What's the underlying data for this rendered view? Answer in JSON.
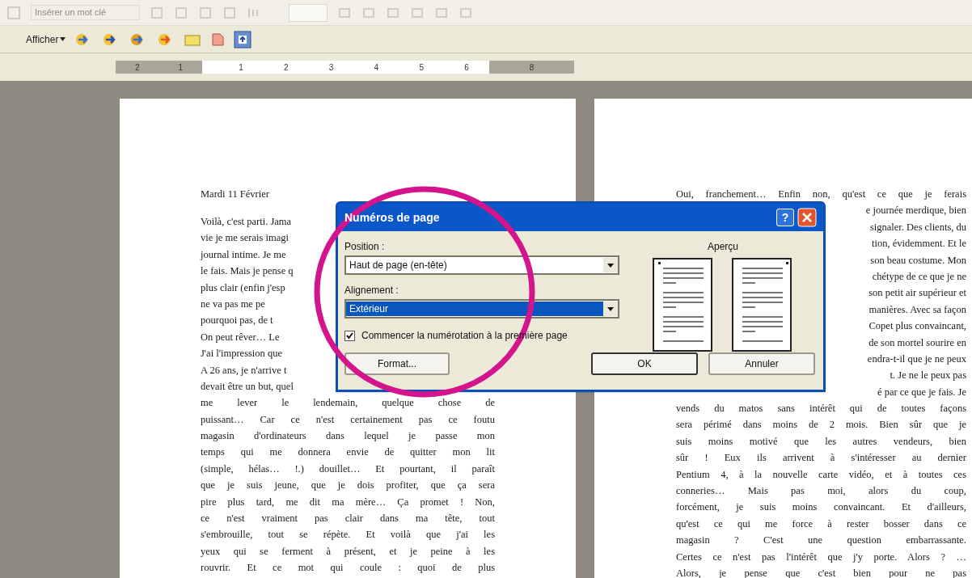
{
  "toolbar": {
    "keyword_field": "Insérer un mot clé",
    "view_menu": "Afficher"
  },
  "ruler": {
    "left_numbers": [
      "2",
      "1"
    ],
    "numbers": [
      "1",
      "2",
      "3",
      "4",
      "5",
      "6"
    ],
    "right_numbers": [
      "8"
    ]
  },
  "pages": [
    {
      "lines": [
        {
          "kind": "heading",
          "text": "Mardi 11 Février"
        },
        {
          "kind": "start",
          "text": "Voilà, c'est parti. Jama"
        },
        {
          "kind": "start",
          "text": "vie je me serais imagi"
        },
        {
          "kind": "start",
          "text": "journal intime. Je me"
        },
        {
          "kind": "start",
          "text": "le fais. Mais je pense q"
        },
        {
          "kind": "start",
          "text": "plus clair (enfin j'esp"
        },
        {
          "kind": "start",
          "text": "ne va pas me pe"
        },
        {
          "kind": "start",
          "text": "pourquoi pas, de t"
        },
        {
          "kind": "start",
          "text": "On peut rêver… Le"
        },
        {
          "kind": "start",
          "text": "J'ai l'impression que"
        },
        {
          "kind": "start",
          "text": "A 26 ans, je n'arrive t"
        },
        {
          "kind": "start",
          "text": "devait être un but, quel"
        },
        {
          "kind": "full",
          "text": "me lever le lendemain, quelque chose de"
        },
        {
          "kind": "full",
          "text": "puissant… Car ce n'est certainement pas ce foutu"
        },
        {
          "kind": "full",
          "text": "magasin d'ordinateurs dans lequel je passe mon"
        },
        {
          "kind": "full",
          "text": "temps qui me donnera envie de quitter mon lit"
        },
        {
          "kind": "full",
          "text": "(simple, hélas… !.) douillet… Et pourtant, il paraît"
        },
        {
          "kind": "full",
          "text": "que je suis jeune, que je dois profiter, que ça sera"
        },
        {
          "kind": "full",
          "text": "pire plus tard, me dit ma mère… Ça promet ! Non,"
        },
        {
          "kind": "full",
          "text": "ce n'est vraiment pas clair dans ma tête, tout"
        },
        {
          "kind": "full",
          "text": "s'embrouille, tout se répète. Et voilà que j'ai les"
        },
        {
          "kind": "full",
          "text": "yeux qui se ferment à présent, et je peine à les"
        },
        {
          "kind": "full",
          "text": "rouvrir. Et ce mot qui coule : quoi de plus"
        }
      ]
    },
    {
      "lines": [
        {
          "kind": "full",
          "text": "Oui, franchement… Enfin non, qu'est ce que je ferais"
        },
        {
          "kind": "end",
          "text": "e journée merdique, bien"
        },
        {
          "kind": "end",
          "text": "signaler. Des clients, du"
        },
        {
          "kind": "end",
          "text": "tion, évidemment. Et le"
        },
        {
          "kind": "end",
          "text": "son beau costume. Mon"
        },
        {
          "kind": "end",
          "text": "chétype de ce que je ne"
        },
        {
          "kind": "end",
          "text": "son petit air supérieur et"
        },
        {
          "kind": "end",
          "text": "manières. Avec sa façon"
        },
        {
          "kind": "end",
          "text": "Copet plus convaincant,"
        },
        {
          "kind": "end",
          "text": "de son mortel sourire en"
        },
        {
          "kind": "end",
          "text": "endra-t-il que je ne peux"
        },
        {
          "kind": "end",
          "text": "t. Je ne le peux pas"
        },
        {
          "kind": "end",
          "text": "é par ce que je fais. Je"
        },
        {
          "kind": "full",
          "text": "vends du matos sans intérêt qui de toutes façons"
        },
        {
          "kind": "full",
          "text": "sera périmé dans moins de 2 mois. Bien sûr que je"
        },
        {
          "kind": "full",
          "text": "suis moins motivé que les autres vendeurs, bien"
        },
        {
          "kind": "full",
          "text": "sûr ! Eux ils arrivent à s'intéresser au dernier"
        },
        {
          "kind": "full",
          "text": "Pentium 4, à la nouvelle carte vidéo, et à toutes ces"
        },
        {
          "kind": "full",
          "text": "conneries… Mais pas moi, alors du coup,"
        },
        {
          "kind": "full",
          "text": "forcément, je suis moins convaincant. Et d'ailleurs,"
        },
        {
          "kind": "full",
          "text": "qu'est ce qui me force à rester bosser dans ce"
        },
        {
          "kind": "full",
          "text": "magasin ? C'est une question embarrassante."
        },
        {
          "kind": "full",
          "text": "Certes ce n'est pas l'intérêt que j'y porte. Alors ? …"
        },
        {
          "kind": "full",
          "text": "Alors, je pense que c'est bien pour ne pas"
        }
      ]
    }
  ],
  "dialog": {
    "title": "Numéros de page",
    "help": "?",
    "position_label": "Position :",
    "position_value": "Haut de page (en-tête)",
    "alignment_label": "Alignement :",
    "alignment_value": "Extérieur",
    "alignment_selected": true,
    "first_page_checkbox": {
      "label": "Commencer la numérotation à la première page",
      "checked": true
    },
    "preview_label": "Aperçu",
    "buttons": [
      "Format...",
      "OK",
      "Annuler"
    ]
  }
}
